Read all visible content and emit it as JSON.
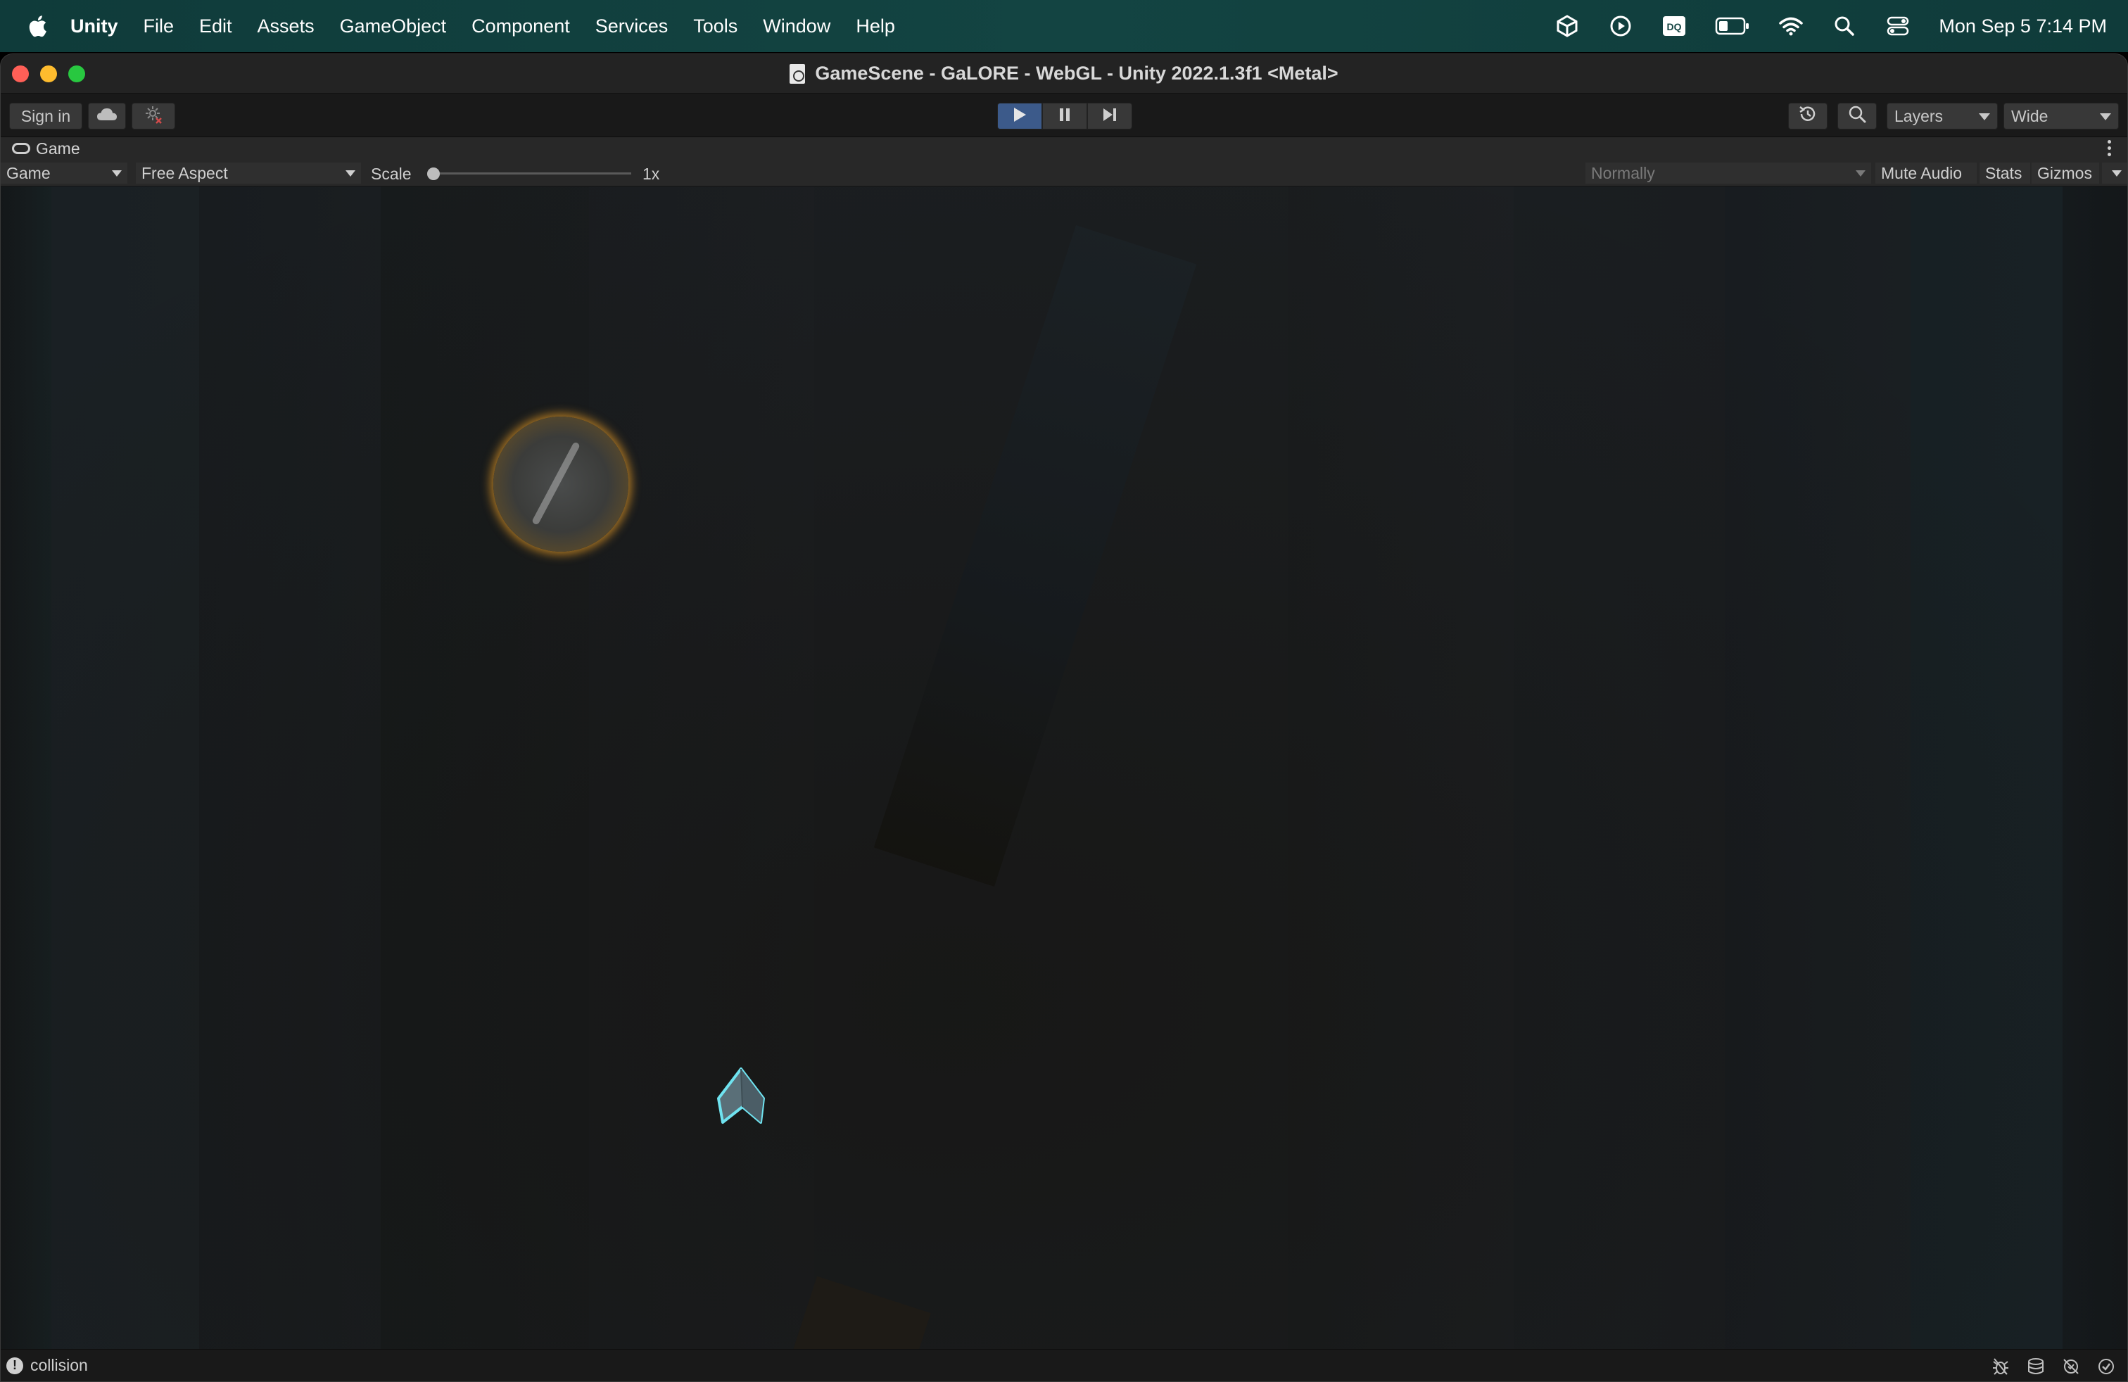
{
  "menubar": {
    "app_name": "Unity",
    "items": [
      "File",
      "Edit",
      "Assets",
      "GameObject",
      "Component",
      "Services",
      "Tools",
      "Window",
      "Help"
    ],
    "clock": "Mon Sep 5  7:14 PM",
    "status_icons": [
      "unity-hub-icon",
      "play-circle-icon",
      "dq-icon",
      "battery-icon",
      "wifi-icon",
      "search-icon",
      "control-center-icon"
    ],
    "dq_label": "DQ"
  },
  "window": {
    "title": "GameScene - GaLORE - WebGL - Unity 2022.1.3f1 <Metal>"
  },
  "toolbar": {
    "sign_in_label": "Sign in",
    "layers_label": "Layers",
    "layout_label": "Wide",
    "play_state": "playing"
  },
  "game_tab": {
    "label": "Game"
  },
  "game_controls": {
    "display_label": "Game",
    "aspect_label": "Free Aspect",
    "scale_label": "Scale",
    "scale_value": "1x",
    "scale_fraction": 0,
    "play_mode_label": "Normally",
    "mute_audio_label": "Mute Audio",
    "stats_label": "Stats",
    "gizmos_label": "Gizmos"
  },
  "statusbar": {
    "message": "collision",
    "info_icon": "!"
  },
  "colors": {
    "menubar": "#134442",
    "play_active": "#3c5a8a",
    "orb_glow": "#f0b440",
    "ship_outline": "#6fe3f0"
  }
}
